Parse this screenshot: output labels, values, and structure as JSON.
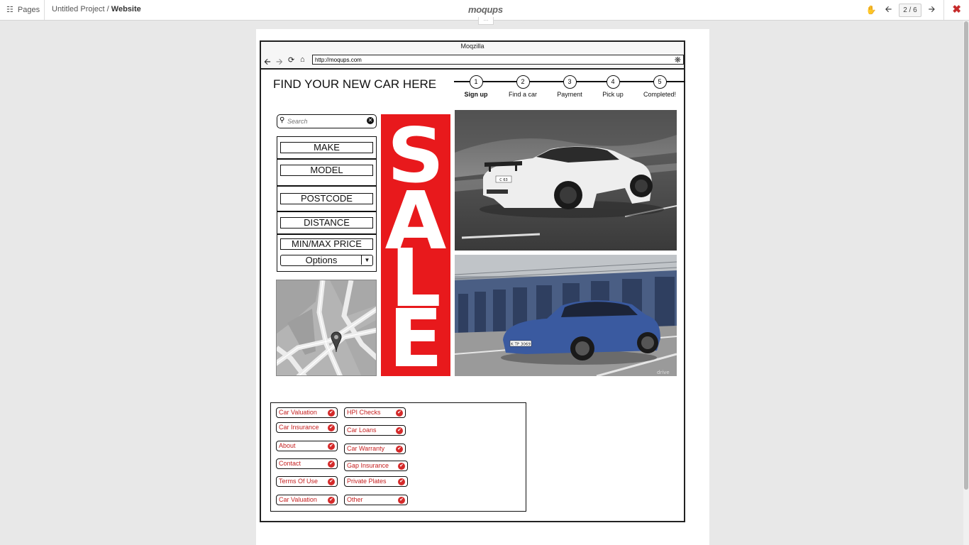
{
  "topbar": {
    "pages_label": "Pages",
    "project": "Untitled Project",
    "separator": " / ",
    "page": "Website",
    "logo": "moqups",
    "handle": "...",
    "pager": "2 / 6"
  },
  "browser": {
    "title": "Moqzilla",
    "url": "http://moqups.com"
  },
  "heading": "FIND YOUR NEW CAR HERE",
  "steps": [
    {
      "num": "1",
      "label": "Sign up",
      "active": true
    },
    {
      "num": "2",
      "label": "Find a car"
    },
    {
      "num": "3",
      "label": "Payment"
    },
    {
      "num": "4",
      "label": "Pick up"
    },
    {
      "num": "5",
      "label": "Completed!"
    }
  ],
  "search": {
    "placeholder": "Search"
  },
  "filters": {
    "make": "MAKE",
    "model": "MODEL",
    "postcode": "POSTCODE",
    "distance": "DISTANCE",
    "price": "MIN/MAX PRICE",
    "options": "Options"
  },
  "sale_banner": "SALE",
  "photos": {
    "plate1": "C 63",
    "plate2": "K·TP 3069",
    "watermark": "drive"
  },
  "links_left": [
    "Car Valuation",
    "Car Insurance",
    "About",
    "Contact",
    "Terms Of Use",
    "Car Valuation"
  ],
  "links_right": [
    "HPI Checks",
    "Car Loans",
    "Car Warranty",
    "Gap Insurance",
    "Private Plates",
    "Other"
  ],
  "colors": {
    "accent": "#e8191c",
    "link": "#c62020",
    "check": "#d42a2a",
    "close": "#c62b2b"
  },
  "icons": {
    "pages": "sitemap-icon",
    "back": "arrow-left-icon",
    "forward": "arrow-right-icon",
    "reload": "reload-icon",
    "home": "home-icon",
    "search": "search-icon",
    "clear": "close-circle-icon",
    "check": "check-circle-icon",
    "map_pin": "map-pin-icon"
  }
}
